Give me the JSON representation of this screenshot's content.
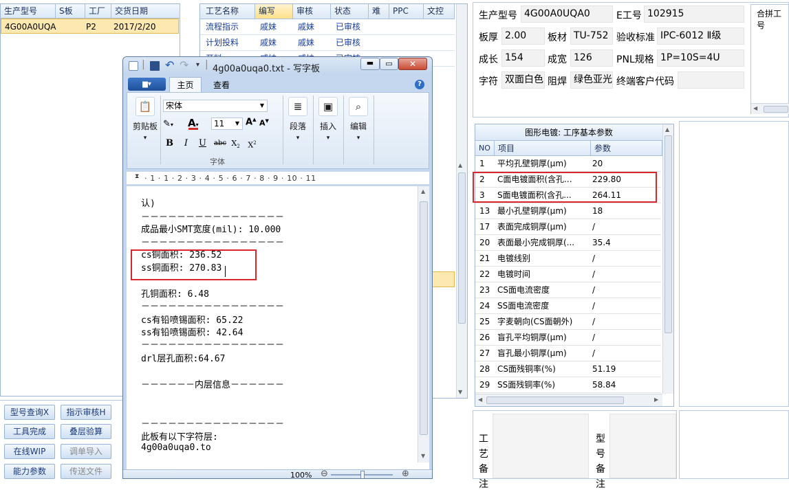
{
  "left_grid": {
    "headers": [
      "生产型号",
      "S板",
      "工厂",
      "交货日期"
    ],
    "row": {
      "model": "4G00A0UQA0",
      "s": "",
      "factory": "P2",
      "date": "2017/2/20"
    }
  },
  "process_grid": {
    "headers": [
      "工艺名称",
      "编写",
      "审核",
      "状态",
      "难",
      "PPC",
      "文控"
    ],
    "rows": [
      [
        "流程指示",
        "戚妹",
        "戚妹",
        "已审核"
      ],
      [
        "计划投料",
        "戚妹",
        "戚妹",
        "已审核"
      ],
      [
        "开料",
        "戚妹",
        "戚妹",
        "已审核"
      ]
    ]
  },
  "buttons": {
    "model_query": "型号查询X",
    "instr_review": "指示审核H",
    "tool_done": "工具完成",
    "stack_verify": "叠层验算",
    "online_wip": "在线WIP",
    "order_import": "调单导入",
    "capability": "能力参数",
    "send_file": "传送文件"
  },
  "info": {
    "model_label": "生产型号",
    "model": "4G00A0UQA0",
    "eng_label": "E工号",
    "eng": "102915",
    "thickness_label": "板厚",
    "thickness": "2.00",
    "material_label": "板材",
    "material": "TU-752",
    "accept_label": "验收标准",
    "accept": "IPC-6012 Ⅱ级",
    "length_label": "成长",
    "length": "154",
    "width_label": "成宽",
    "width": "126",
    "pnl_label": "PNL规格",
    "pnl": "1P=10S=4U",
    "char_label": "字符",
    "char": "双面白色",
    "mask_label": "阻焊",
    "mask": "绿色亚光",
    "customer_label": "终端客户代码",
    "customer": "",
    "combine_label": "合拼工号"
  },
  "params": {
    "title": "图形电镀: 工序基本参数",
    "col_no": "NO",
    "col_item": "项目",
    "col_val": "参数",
    "rows": [
      [
        "1",
        "平均孔壁铜厚(μm)",
        "20"
      ],
      [
        "2",
        "C面电镀面积(含孔...",
        "229.80"
      ],
      [
        "3",
        "S面电镀面积(含孔...",
        "264.11"
      ],
      [
        "13",
        "最小孔壁铜厚(μm)",
        "18"
      ],
      [
        "17",
        "表面完成铜厚(μm)",
        "/"
      ],
      [
        "20",
        "表面最小完成铜厚(...",
        "35.4"
      ],
      [
        "21",
        "电镀线别",
        "/"
      ],
      [
        "22",
        "电镀时间",
        "/"
      ],
      [
        "23",
        "CS面电流密度",
        "/"
      ],
      [
        "24",
        "SS面电流密度",
        "/"
      ],
      [
        "25",
        "字麦朝向(CS面朝外)",
        "/"
      ],
      [
        "26",
        "盲孔平均铜厚(μm)",
        "/"
      ],
      [
        "27",
        "盲孔最小铜厚(μm)",
        "/"
      ],
      [
        "28",
        "CS面残铜率(%)",
        "51.19"
      ],
      [
        "29",
        "SS面残铜率(%)",
        "58.84"
      ]
    ]
  },
  "remarks": {
    "craft": "工艺备注",
    "model": "型号备注"
  },
  "notepad": {
    "title": "4g00a0uqa0.txt - 写字板",
    "tab_home": "主页",
    "tab_view": "查看",
    "font_name": "宋体",
    "font_size": "11",
    "clipboard": "剪贴板",
    "paragraph": "段落",
    "insert": "插入",
    "edit": "编辑",
    "font_group": "字体",
    "zoom": "100%",
    "ruler": "· 1 · 1 · 2 · 3 · 4 · 5 · 6 · 7 · 8 · 9 · 10 · 11",
    "lines": [
      "认)",
      "－－－－－－－－－－－－－－－－",
      "成品最小SMT宽度(mil): 10.000",
      "－－－－－－－－－－－－－－－－",
      "cs铜面积: 236.52",
      "ss铜面积: 270.83",
      "",
      "孔铜面积: 6.48",
      "－－－－－－－－－－－－－－－－",
      "cs有铅喷锡面积: 65.22",
      "ss有铅喷锡面积: 42.64",
      "－－－－－－－－－－－－－－－－",
      "drl层孔面积:64.67",
      "",
      "－－－－－－内层信息－－－－－－",
      "",
      "",
      "－－－－－－－－－－－－－－－－",
      "此板有以下字符层:",
      "4g00a0uqa0.to"
    ]
  },
  "colors": {
    "selection": "#fde9b0",
    "redbox": "#d9262c",
    "header": "#dbe8f6"
  }
}
